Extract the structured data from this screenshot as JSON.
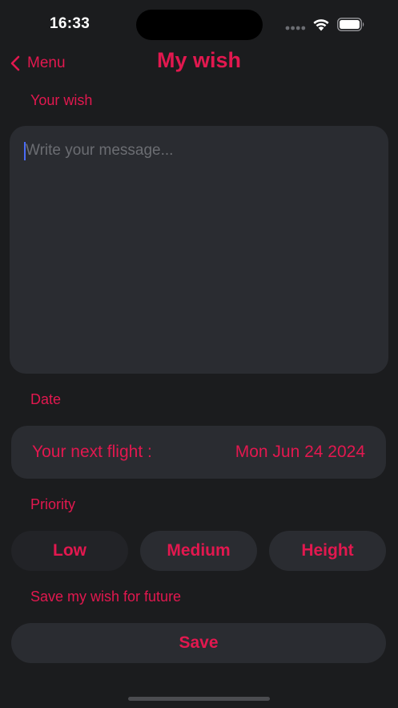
{
  "status_bar": {
    "time": "16:33",
    "signal_icon": "signal-dots-icon",
    "wifi_icon": "wifi-icon",
    "battery_icon": "battery-full-icon"
  },
  "nav": {
    "back_label": "Menu",
    "back_icon": "chevron-left-icon",
    "title": "My wish"
  },
  "wish_section": {
    "label": "Your wish",
    "placeholder": "Write your message...",
    "value": ""
  },
  "date_section": {
    "label": "Date",
    "flight_label": "Your next flight :",
    "flight_date": "Mon Jun 24 2024"
  },
  "priority_section": {
    "label": "Priority",
    "options": [
      {
        "label": "Low",
        "selected": true
      },
      {
        "label": "Medium",
        "selected": false
      },
      {
        "label": "Height",
        "selected": false
      }
    ]
  },
  "save_section": {
    "label": "Save my wish for future",
    "button_label": "Save"
  },
  "colors": {
    "accent": "#e2184f",
    "background": "#1b1c1e",
    "surface": "#2a2c31",
    "caret": "#4a6cf7"
  }
}
